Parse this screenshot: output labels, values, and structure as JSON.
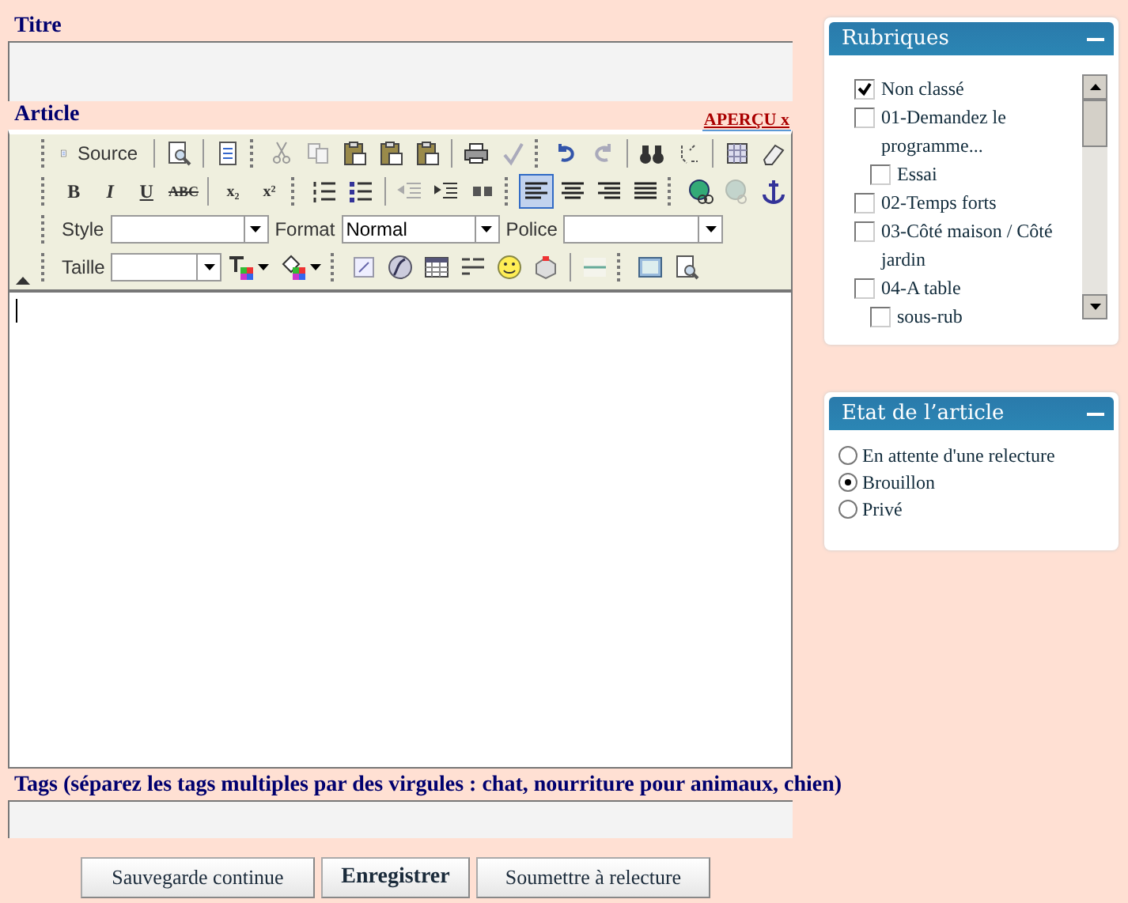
{
  "title_field": {
    "label": "Titre"
  },
  "article": {
    "label": "Article",
    "preview_link": "APERÇU x",
    "source_label": "Source",
    "format_buttons": [
      "B",
      "I",
      "U",
      "ABC",
      "x₂",
      "x²"
    ],
    "align_buttons": [
      {
        "selected": true
      },
      {
        "selected": false
      },
      {
        "selected": false
      },
      {
        "selected": false
      }
    ],
    "combos": [
      {
        "label": "Style"
      },
      {
        "label": "Format",
        "value": "Normal"
      },
      {
        "label": "Police"
      }
    ],
    "size_combo": {
      "label": "Taille"
    }
  },
  "tags": {
    "label": "Tags (séparez les tags multiples par des virgules : chat, nourriture pour animaux, chien)"
  },
  "buttons": [
    {
      "label": "Sauvegarde continue",
      "primary": false
    },
    {
      "label": "Enregistrer",
      "primary": true
    },
    {
      "label": "Soumettre à relecture",
      "primary": false
    }
  ],
  "rubriques": {
    "title": "Rubriques",
    "items": [
      {
        "label": "Non classé",
        "checked": true
      },
      {
        "label": "01-Demandez le programme...",
        "checked": false,
        "children": [
          {
            "label": "Essai",
            "checked": false
          }
        ]
      },
      {
        "label": "02-Temps forts",
        "checked": false
      },
      {
        "label": "03-Côté maison / Côté jardin",
        "checked": false
      },
      {
        "label": "04-A table",
        "checked": false,
        "children": [
          {
            "label": "sous-rub",
            "checked": false
          }
        ]
      }
    ]
  },
  "etat": {
    "title": "Etat de l’article",
    "options": [
      {
        "label": "En attente d'une relecture",
        "selected": false
      },
      {
        "label": "Brouillon",
        "selected": true
      },
      {
        "label": "Privé",
        "selected": false
      }
    ]
  }
}
